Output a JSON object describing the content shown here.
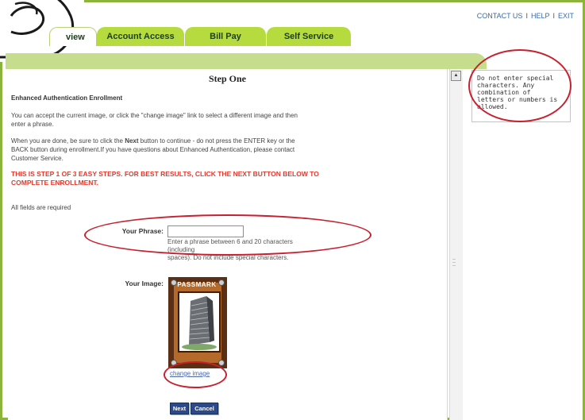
{
  "utility_nav": {
    "contact": "CONTACT US",
    "help": "HELP",
    "exit": "EXIT",
    "sep": "I"
  },
  "big_number": "3",
  "tabs": [
    {
      "label": "view"
    },
    {
      "label": "Account Access"
    },
    {
      "label": "Bill Pay"
    },
    {
      "label": "Self Service"
    }
  ],
  "step_title": "Step One",
  "content": {
    "heading": "Enhanced Authentication Enrollment",
    "para1_line1": "You can accept the current image, or click the \"change image\" link to select a different image and then",
    "para1_line2": "enter a phrase.",
    "para2_line1_a": "When you are done, be sure to click the ",
    "para2_line1_b": "Next",
    "para2_line1_c": " button to continue - do not press the ENTER key or the",
    "para2_line2": "BACK button during enrollment.If you have questions about Enhanced Authentication, please contact",
    "para2_line3": "Customer Service.",
    "warning_line1": "THIS IS STEP 1 OF 3 EASY STEPS. FOR BEST RESULTS, CLICK THE NEXT BUTTON BELOW TO",
    "warning_line2": "COMPLETE ENROLLMENT.",
    "required_note": "All fields are required"
  },
  "form": {
    "phrase_label": "Your Phrase:",
    "phrase_value": "",
    "phrase_help_line1": "Enter a phrase between 6 and 20 characters (including",
    "phrase_help_line2": "spaces). Do not include special characters.",
    "image_label": "Your Image:",
    "image_brand": "PASSMARK",
    "change_image": "change image",
    "next_button": "Next",
    "cancel_button": "Cancel"
  },
  "tip": {
    "line1": "Do not enter special",
    "line2": "characters. Any",
    "line3": "combination of",
    "line4": "letters or numbers is",
    "line5": "allowed."
  },
  "colors": {
    "frame_green": "#8cb33a",
    "tab_green": "#b6db3e",
    "banner_green": "#c6dd8e",
    "annotation_red": "#c8202f",
    "button_blue": "#2c4a8a",
    "warning_red": "#e23a2e"
  }
}
